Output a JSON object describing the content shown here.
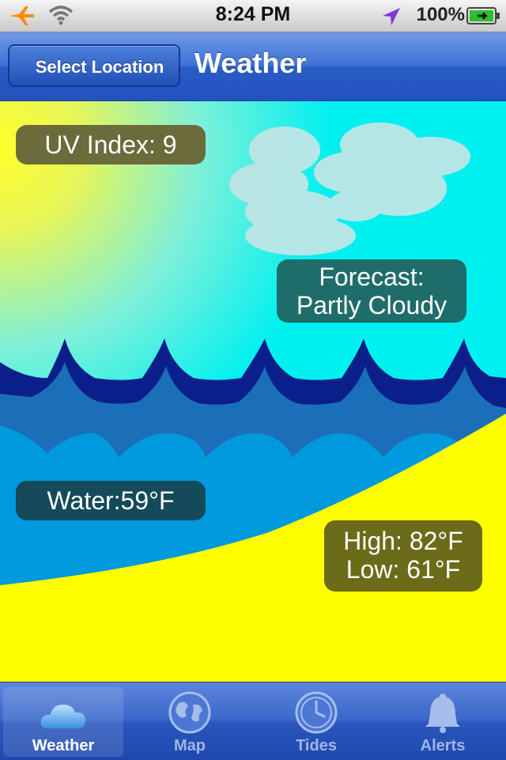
{
  "status_bar": {
    "time": "8:24 PM",
    "battery_percent": "100%",
    "icons": [
      "airplane-mode-icon",
      "wifi-icon",
      "location-arrow-icon",
      "battery-charging-icon"
    ]
  },
  "nav_bar": {
    "back_label": "Select Location",
    "title": "Weather"
  },
  "weather": {
    "uv": "UV Index: 9",
    "forecast_line1": "Forecast:",
    "forecast_line2": "Partly Cloudy",
    "water": "Water:59°F",
    "high": "High: 82°F",
    "low": "Low: 61°F"
  },
  "colors": {
    "sky": "#00f0f0",
    "sun": "#f2f23a",
    "wave_dark": "#0a1f8a",
    "wave_mid": "#1a6fb8",
    "water": "#0099dd",
    "sand": "#ffff00",
    "accent": "#2f63cc"
  },
  "tab_bar": {
    "tabs": [
      {
        "label": "Weather",
        "icon": "cloud-icon",
        "selected": true
      },
      {
        "label": "Map",
        "icon": "globe-icon",
        "selected": false
      },
      {
        "label": "Tides",
        "icon": "clock-icon",
        "selected": false
      },
      {
        "label": "Alerts",
        "icon": "bell-icon",
        "selected": false
      }
    ]
  }
}
